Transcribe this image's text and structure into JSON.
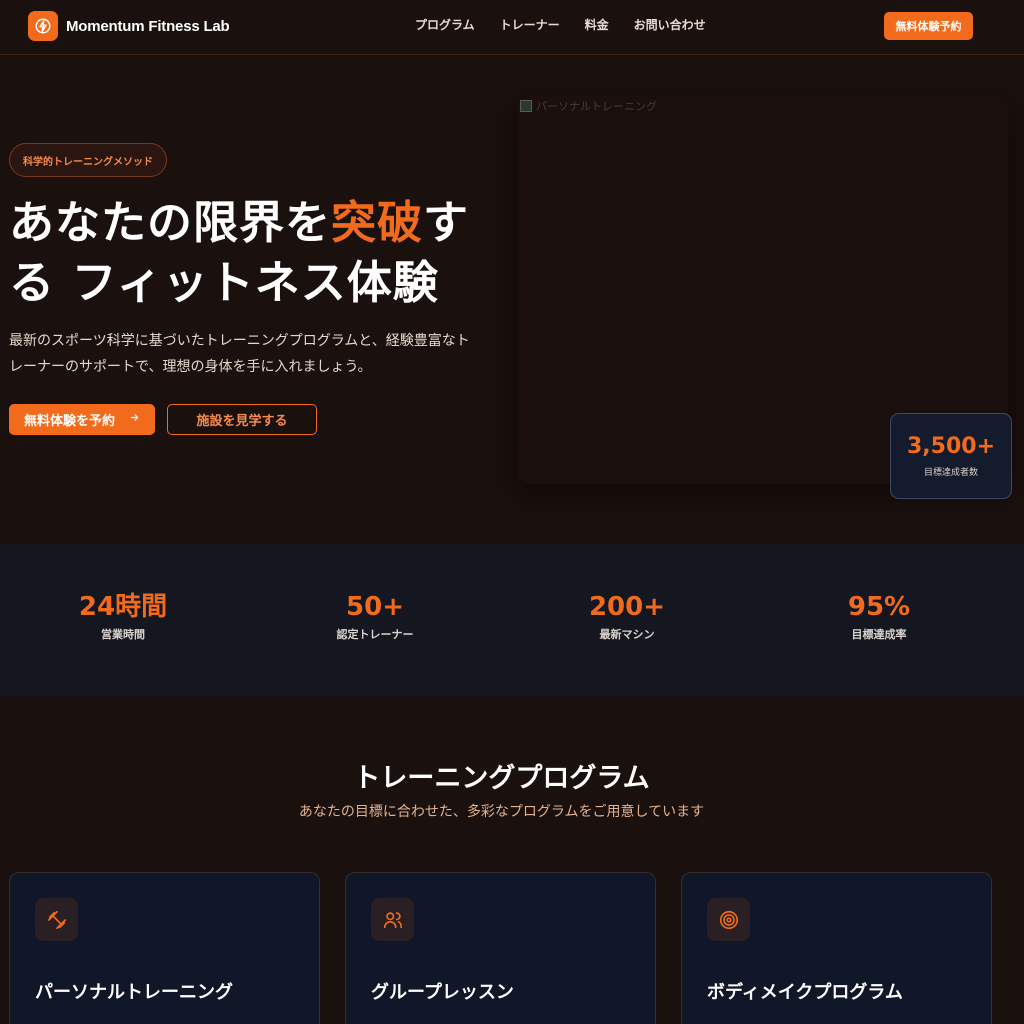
{
  "header": {
    "brand": "Momentum Fitness Lab",
    "logo_icon": "lightning-icon",
    "nav": [
      "プログラム",
      "トレーナー",
      "料金",
      "お問い合わせ"
    ],
    "cta": "無料体験予約"
  },
  "hero": {
    "badge": "科学的トレーニングメソッド",
    "title_part1": "あなたの限界を",
    "title_accent": "突破",
    "title_part2": "する フィットネス体験",
    "description": "最新のスポーツ科学に基づいたトレーニングプログラムと、経験豊富なトレーナーのサポートで、理想の身体を手に入れましょう。",
    "primary_button": "無料体験を予約",
    "primary_button_icon": "arrow-right-icon",
    "secondary_button": "施設を見学する",
    "image_alt": "パーソナルトレーニング",
    "stat_card": {
      "value": "3,500+",
      "label": "目標達成者数"
    }
  },
  "stats": [
    {
      "value": "24時間",
      "label": "営業時間"
    },
    {
      "value": "50+",
      "label": "認定トレーナー"
    },
    {
      "value": "200+",
      "label": "最新マシン"
    },
    {
      "value": "95%",
      "label": "目標達成率"
    }
  ],
  "programs": {
    "title": "トレーニングプログラム",
    "subtitle": "あなたの目標に合わせた、多彩なプログラムをご用意しています",
    "cards": [
      {
        "title": "パーソナルトレーニング",
        "icon": "dumbbell-icon"
      },
      {
        "title": "グループレッスン",
        "icon": "users-icon"
      },
      {
        "title": "ボディメイクプログラム",
        "icon": "target-icon"
      }
    ]
  },
  "colors": {
    "accent": "#f26a1b",
    "background": "#1a100d",
    "band": "#151720",
    "card": "#101728"
  }
}
